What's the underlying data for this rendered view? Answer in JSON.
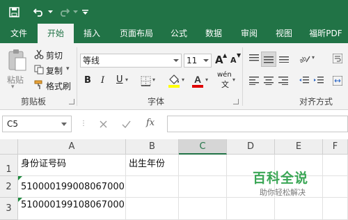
{
  "quick_access": {
    "save_icon": "save-icon",
    "undo_icon": "undo-icon",
    "redo_icon": "redo-icon",
    "customize_icon": "customize-icon"
  },
  "tabs": [
    {
      "label": "文件"
    },
    {
      "label": "开始",
      "active": true
    },
    {
      "label": "插入"
    },
    {
      "label": "页面布局"
    },
    {
      "label": "公式"
    },
    {
      "label": "数据"
    },
    {
      "label": "审阅"
    },
    {
      "label": "视图"
    },
    {
      "label": "福昕PDF"
    }
  ],
  "clipboard": {
    "paste_label": "粘贴",
    "cut_label": "剪切",
    "copy_label": "复制",
    "format_painter_label": "格式刷",
    "group_label": "剪贴板"
  },
  "font": {
    "name": "等线",
    "size": "11",
    "group_label": "字体",
    "bold": "B",
    "italic": "I",
    "underline": "U",
    "grow": "A",
    "shrink": "A",
    "phonetic": "wén"
  },
  "alignment": {
    "group_label": "对齐方式"
  },
  "formula_bar": {
    "name_box": "C5",
    "fx_label": "fx",
    "formula": ""
  },
  "columns": [
    "A",
    "B",
    "C",
    "D",
    "E",
    "F"
  ],
  "selected_column": "C",
  "rows": [
    {
      "num": "1",
      "a": "身份证号码",
      "b": "出生年份"
    },
    {
      "num": "2",
      "a": "510000199008067000",
      "b": ""
    },
    {
      "num": "3",
      "a": "510000199108067000",
      "b": ""
    }
  ],
  "watermark": {
    "title": "百科全说",
    "subtitle": "助你轻松解决"
  },
  "colors": {
    "accent": "#217346",
    "accent_dark": "#1e6b40",
    "ribbon": "#f3f3f3",
    "fill_highlight": "#ffff00",
    "font_red": "#e00000",
    "watermark": "#3aa655"
  }
}
